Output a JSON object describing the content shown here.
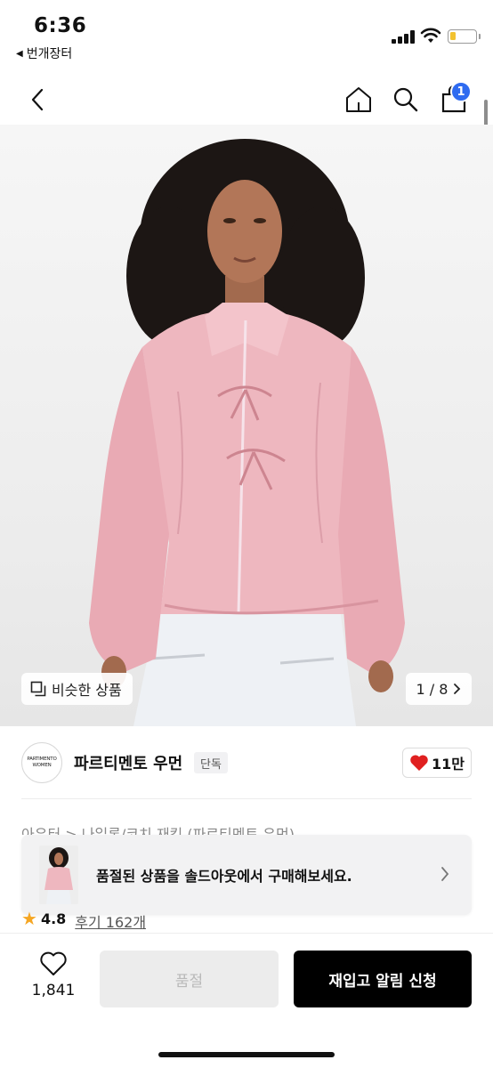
{
  "status_bar": {
    "time": "6:36",
    "back_app_label": "번개장터",
    "battery_color": "#f2c230"
  },
  "nav": {
    "icons": [
      "back-chevron-icon",
      "home-icon",
      "search-icon",
      "shopping-bag-icon"
    ],
    "cart_count": "1",
    "badge_color": "#2f6bf0"
  },
  "gallery": {
    "similar_label": "비슷한 상품",
    "page_indicator": "1 / 8"
  },
  "brand": {
    "logo_line1": "PARTIMENTO",
    "logo_line2": "WOMEN",
    "name": "파르티멘토 우먼",
    "exclusive_label": "단독",
    "like_count": "11만",
    "heart_color": "#e02020"
  },
  "category": {
    "text": "아우터 > 나일론/코치 재킷 (파르티멘토 우먼)"
  },
  "soldout_toast": {
    "message": "품절된 상품을 솔드아웃에서 구매해보세요."
  },
  "rating": {
    "value": "4.8",
    "reviews_label": "후기 162개"
  },
  "bottom_bar": {
    "wish_count": "1,841",
    "soldout_label": "품절",
    "restock_label": "재입고 알림 신청"
  }
}
